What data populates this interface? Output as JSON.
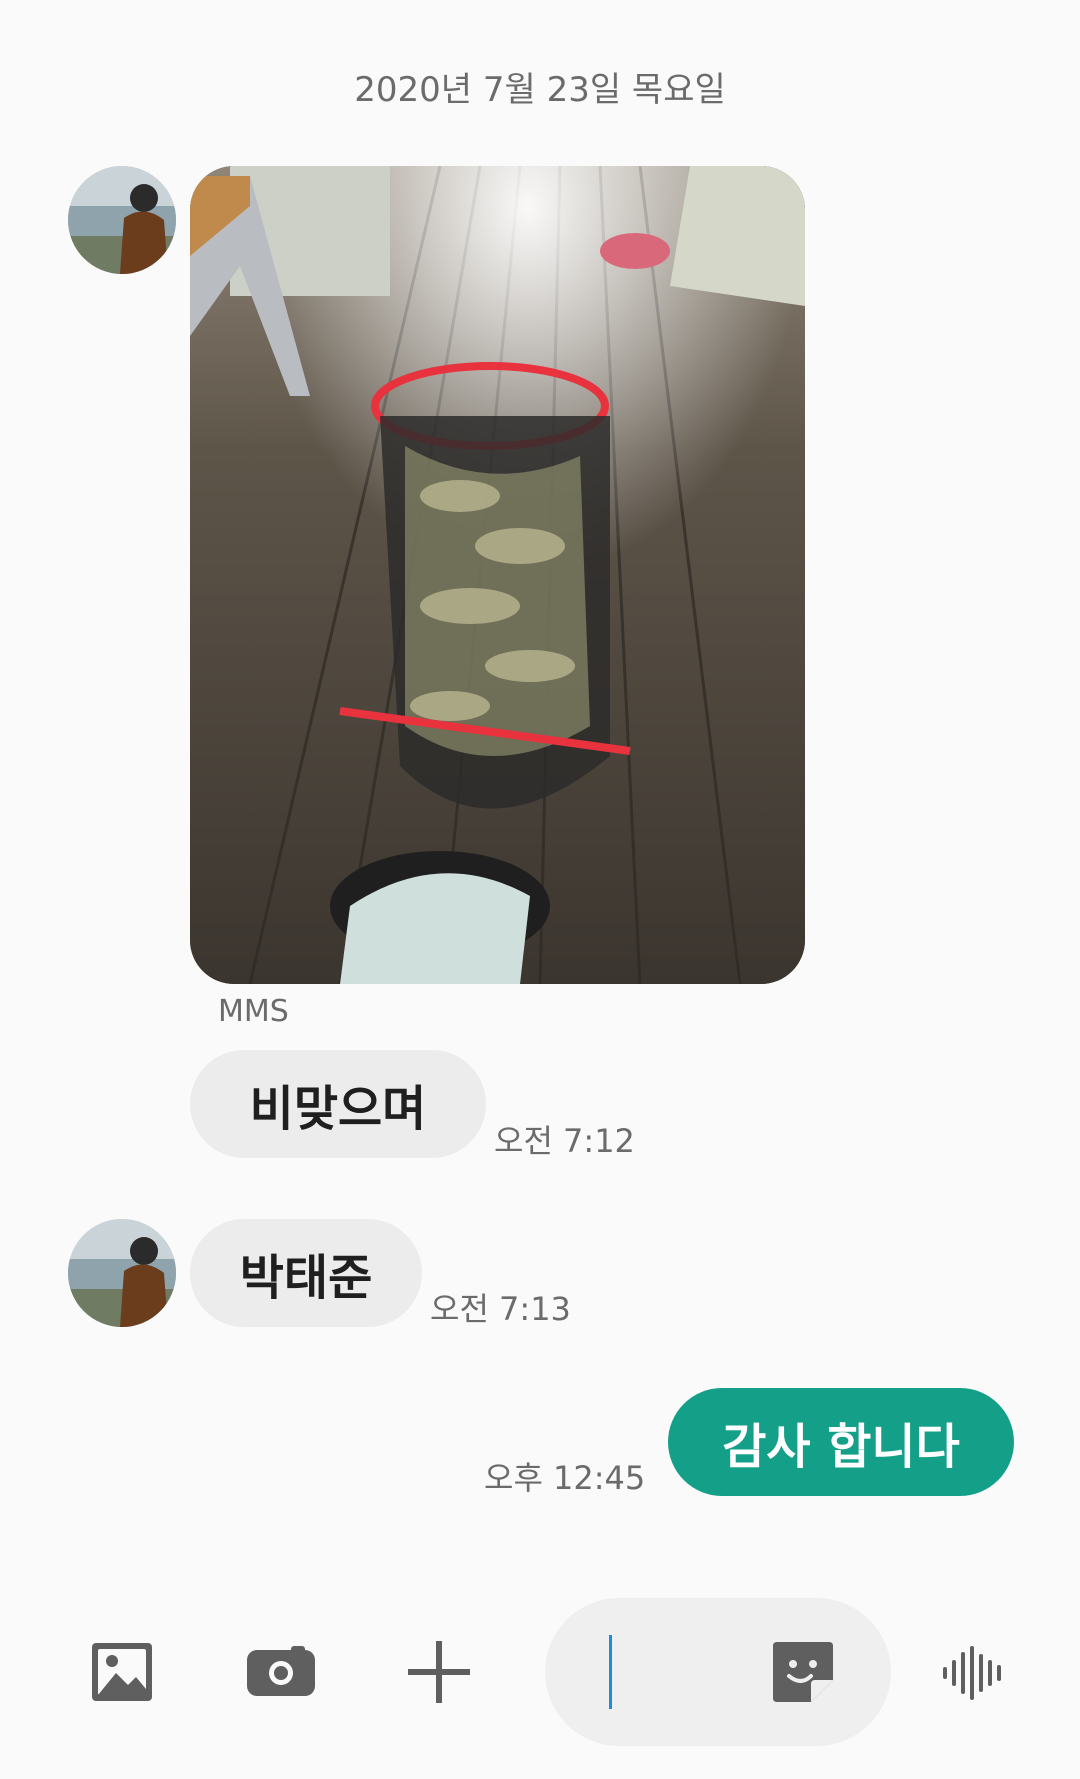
{
  "conversation": {
    "date_header": "2020년 7월 23일 목요일",
    "messages": [
      {
        "direction": "incoming",
        "type": "image",
        "image_description_icon": "photo-thumbnail",
        "type_label": "MMS"
      },
      {
        "direction": "incoming",
        "type": "text",
        "text": "비맞으며",
        "time": "오전 7:12"
      },
      {
        "direction": "incoming",
        "type": "text",
        "text": "박태준",
        "time": "오전 7:13"
      },
      {
        "direction": "outgoing",
        "type": "text",
        "text": "감사 합니다",
        "time": "오후 12:45"
      }
    ]
  },
  "composer": {
    "value": "",
    "icons": {
      "gallery": "image-icon",
      "camera": "camera-icon",
      "more": "plus-icon",
      "sticker": "sticker-icon",
      "voice": "voice-wave-icon"
    }
  },
  "colors": {
    "outgoing_bubble": "#14a088",
    "incoming_bubble": "#ececec",
    "icon_gray": "#5f5f5f",
    "cursor": "#1a8fd6"
  }
}
